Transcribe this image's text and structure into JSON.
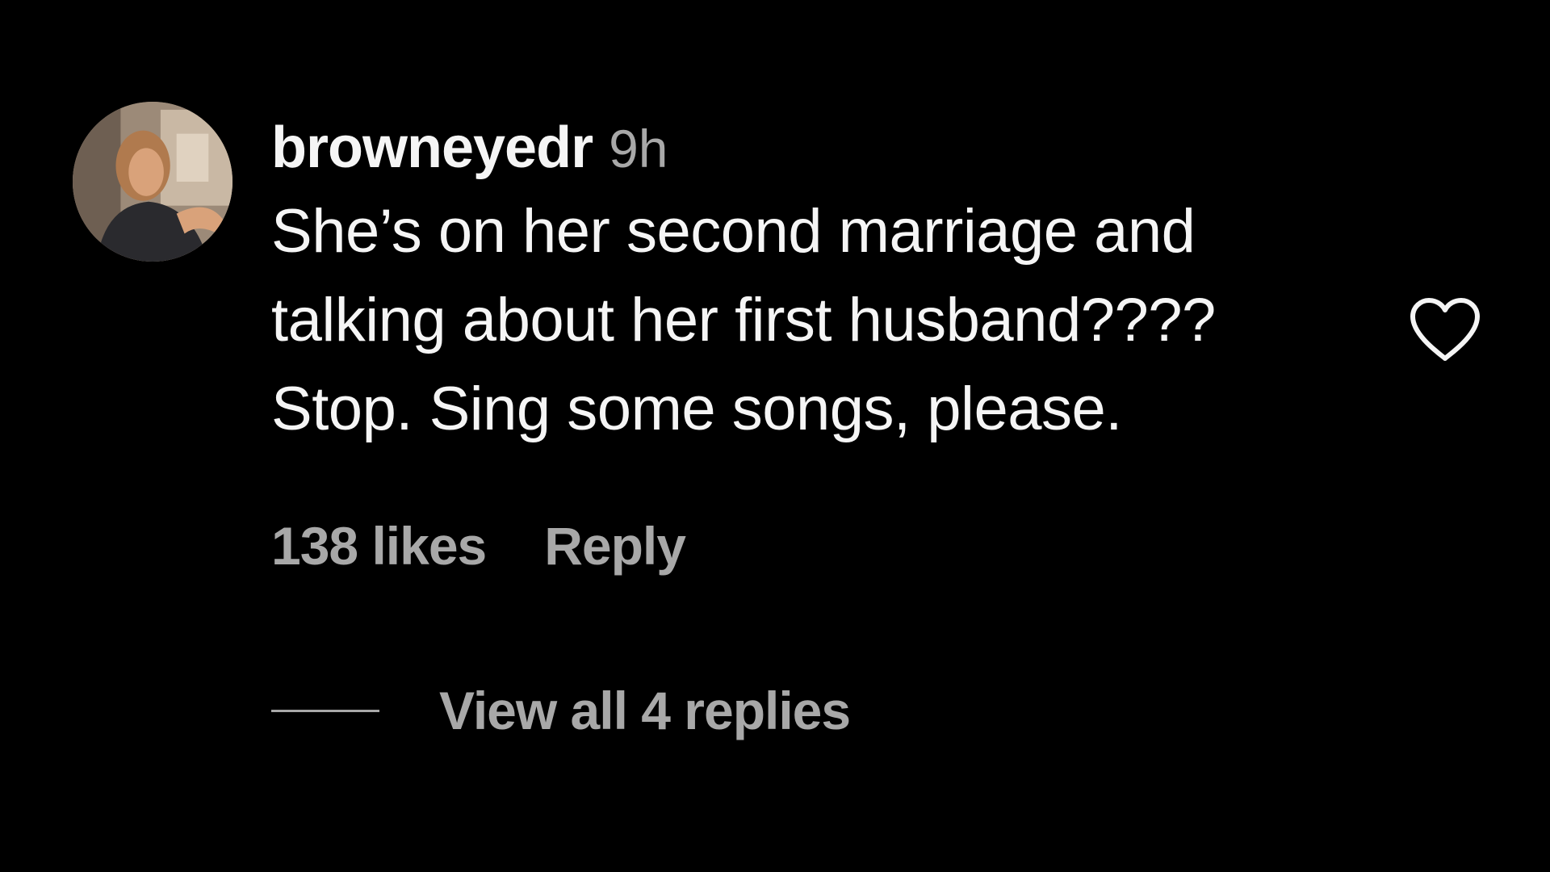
{
  "comment": {
    "username": "browneyedr",
    "timestamp": "9h",
    "text_lines": [
      "She’s on her second marriage and",
      "talking about her first husband????",
      "Stop. Sing some songs, please."
    ],
    "likes": "138 likes",
    "reply_label": "Reply",
    "view_replies_label": "View all 4 replies"
  },
  "icons": {
    "like": "heart-outline-icon",
    "avatar": "user-avatar-photo"
  },
  "colors": {
    "background": "#000000",
    "primary_text": "#f5f5f5",
    "secondary_text": "#a8a8a8"
  }
}
